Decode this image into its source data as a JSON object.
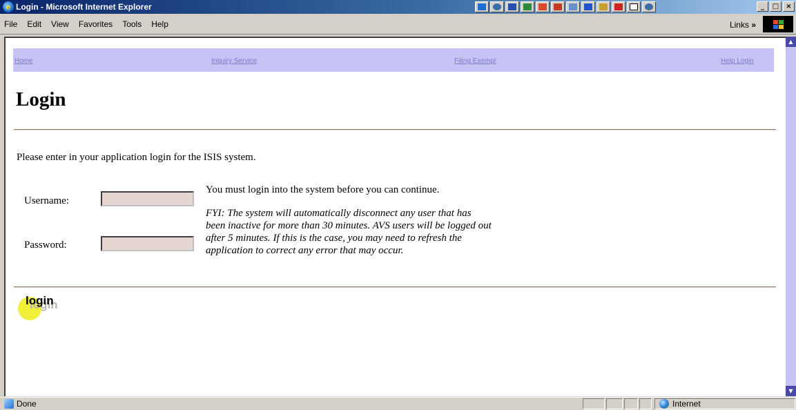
{
  "window": {
    "title": "Login - Microsoft Internet Explorer",
    "controls": [
      "_",
      "□",
      "×"
    ]
  },
  "tray_icons": [
    "ie-icon",
    "ie-icon",
    "word-icon",
    "excel-icon",
    "outlook-icon",
    "powerpoint-icon",
    "ie-icon",
    "ie-icon",
    "ie-icon",
    "ie-icon",
    "ie-icon",
    "ie-icon"
  ],
  "menu": {
    "items": [
      "File",
      "Edit",
      "View",
      "Favorites",
      "Tools",
      "Help"
    ],
    "links_label": "Links",
    "links_chevron": "»"
  },
  "nav": {
    "home": "Home",
    "inquiry": "Inquiry Service",
    "filing": "Filing Exempt",
    "help_login": "Help Login",
    "link_color": "#7a7acb",
    "bg_color": "#c8c3f5"
  },
  "page": {
    "title": "Login",
    "intro": "Please enter in your application login for the ISIS system.",
    "username_label": "Username:",
    "password_label": "Password:",
    "username_value": "",
    "password_value": "",
    "notice": "You must login into the system before you can continue.",
    "fyi_lines": [
      "FYI: The system will automatically disconnect any user that has",
      "been inactive for more than 30 minutes. AVS users will be logged out",
      "after 5 minutes. If this is the case, you may need to refresh the",
      "application to correct any error that may occur."
    ],
    "login_button": "login"
  },
  "status": {
    "text": "Done",
    "zone": "Internet"
  }
}
